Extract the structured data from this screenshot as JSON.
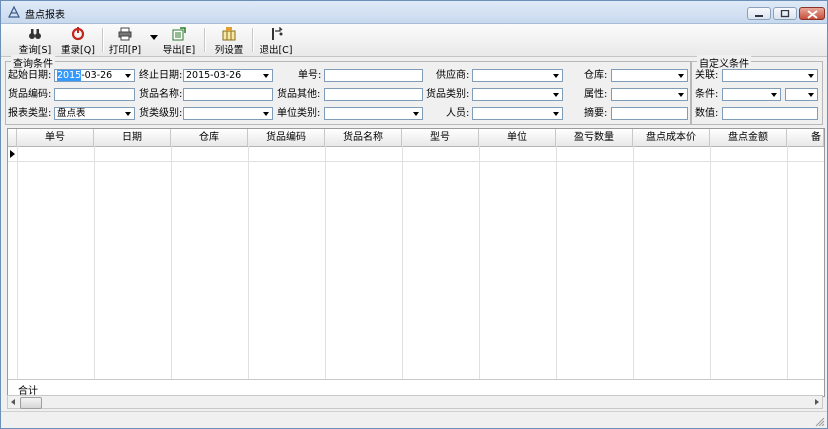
{
  "window": {
    "title": "盘点报表"
  },
  "toolbar": {
    "query": "查询[S]",
    "reset": "重录[Q]",
    "print": "打印[P]",
    "export": "导出[E]",
    "columns": "列设置",
    "exit": "退出[C]"
  },
  "query_panel": {
    "legend": "查询条件",
    "start_date_label": "起始日期:",
    "start_date_year": "2015",
    "start_date_rest": "-03-26",
    "end_date_label": "终止日期:",
    "end_date_value": "2015-03-26",
    "order_no_label": "单号:",
    "order_no_value": "",
    "supplier_label": "供应商:",
    "supplier_value": "",
    "warehouse_label": "仓库:",
    "warehouse_value": "",
    "item_code_label": "货品编码:",
    "item_code_value": "",
    "item_name_label": "货品名称:",
    "item_name_value": "",
    "item_other_label": "货品其他:",
    "item_other_value": "",
    "item_category_label": "货品类别:",
    "item_category_value": "",
    "attribute_label": "属性:",
    "attribute_value": "",
    "report_type_label": "报表类型:",
    "report_type_value": "盘点表",
    "category_level_label": "货类级别:",
    "category_level_value": "",
    "unit_category_label": "单位类别:",
    "unit_category_value": "",
    "person_label": "人员:",
    "person_value": "",
    "summary_label": "摘要:",
    "summary_value": ""
  },
  "custom_panel": {
    "legend": "自定义条件",
    "relation_label": "关联:",
    "relation_value": "",
    "condition_label": "条件:",
    "condition_value": "",
    "condition_op_value": "",
    "value_label": "数值:",
    "value_value": ""
  },
  "grid": {
    "columns": [
      "单号",
      "日期",
      "仓库",
      "货品编码",
      "货品名称",
      "型号",
      "单位",
      "盈亏数量",
      "盘点成本价",
      "盘点金额",
      "备"
    ],
    "footer_label": "合计"
  }
}
